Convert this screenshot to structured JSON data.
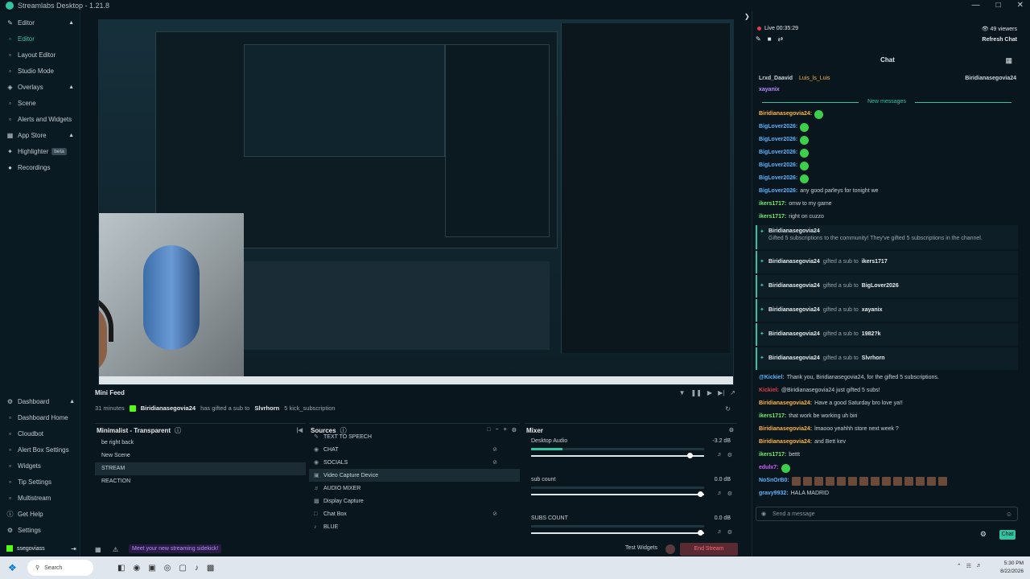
{
  "window": {
    "title": "Streamlabs Desktop - 1.21.8"
  },
  "sidebar": {
    "items": [
      {
        "label": "Editor",
        "kind": "section"
      },
      {
        "label": "Editor",
        "kind": "sub",
        "active": true
      },
      {
        "label": "Layout Editor",
        "kind": "sub"
      },
      {
        "label": "Studio Mode",
        "kind": "sub"
      },
      {
        "label": "Overlays",
        "kind": "section"
      },
      {
        "label": "Scene",
        "kind": "sub"
      },
      {
        "label": "Alerts and Widgets",
        "kind": "sub"
      },
      {
        "label": "App Store",
        "kind": "section"
      },
      {
        "label": "Highlighter",
        "kind": "section",
        "badge": "beta"
      },
      {
        "label": "Recordings",
        "kind": "section"
      }
    ],
    "dashboard": [
      {
        "label": "Dashboard",
        "kind": "section"
      },
      {
        "label": "Dashboard Home",
        "kind": "sub"
      },
      {
        "label": "Cloudbot",
        "kind": "sub"
      },
      {
        "label": "Alert Box Settings",
        "kind": "sub"
      },
      {
        "label": "Widgets",
        "kind": "sub"
      },
      {
        "label": "Tip Settings",
        "kind": "sub"
      },
      {
        "label": "Multistream",
        "kind": "sub"
      },
      {
        "label": "Get Help",
        "kind": "section"
      },
      {
        "label": "Settings",
        "kind": "section"
      }
    ],
    "user": "ssegoviass"
  },
  "minifeed": {
    "title": "Mini Feed",
    "time": "31 minutes",
    "gifter": "Biridianasegovia24",
    "action": "has gifted a sub to",
    "recipient": "Slvrhorn",
    "suffix": "5 kick_subscription"
  },
  "scenes": {
    "title": "Minimalist - Transparent",
    "items": [
      "be right back",
      "New Scene",
      "STREAM",
      "REACTION"
    ],
    "selected": "STREAM"
  },
  "sources": {
    "title": "Sources",
    "items": [
      {
        "label": "TEXT TO SPEECH",
        "icon": "text-icon"
      },
      {
        "label": "CHAT",
        "icon": "browser-icon"
      },
      {
        "label": "SOCIALS",
        "icon": "browser-icon"
      },
      {
        "label": "Video Capture Device",
        "icon": "camera-icon",
        "selected": true
      },
      {
        "label": "AUDIO MIXER",
        "icon": "mixer-icon"
      },
      {
        "label": "Display Capture",
        "icon": "display-icon"
      },
      {
        "label": "Chat Box",
        "icon": "chat-icon"
      },
      {
        "label": "BLUE",
        "icon": "mic-icon"
      }
    ]
  },
  "mixer": {
    "title": "Mixer",
    "channels": [
      {
        "name": "Desktop Audio",
        "db": "-3.2 dB",
        "level": 0.18,
        "fader": 0.92
      },
      {
        "name": "sub count",
        "db": "0.0 dB",
        "level": 0,
        "fader": 0.98
      },
      {
        "name": "SUBS COUNT",
        "db": "0.0 dB",
        "level": 0,
        "fader": 0.98
      }
    ]
  },
  "footer": {
    "sidekick": "Meet your new streaming sidekick!",
    "test_widgets": "Test Widgets",
    "end_stream": "End Stream"
  },
  "chat": {
    "live": "Live 00:35:29",
    "viewers": "49 viewers",
    "refresh": "Refresh Chat",
    "title": "Chat",
    "pinned": [
      "Lrxd_Daavid",
      "Luis_ls_Luis",
      "Biridianasegovia24"
    ],
    "new_messages": "New messages",
    "messages": [
      {
        "user": "xayanix",
        "text": "",
        "color": "#b58cff"
      },
      {
        "user": "Biridianasegovia24:",
        "text": "",
        "color": "#ffb640"
      },
      {
        "user": "BigLover2026:",
        "text": "",
        "color": "#5ab4ff"
      },
      {
        "user": "BigLover2026:",
        "text": "",
        "color": "#5ab4ff"
      },
      {
        "user": "BigLover2026:",
        "text": "",
        "color": "#5ab4ff"
      },
      {
        "user": "BigLover2026:",
        "text": "",
        "color": "#5ab4ff"
      },
      {
        "user": "BigLover2026:",
        "text": "",
        "color": "#5ab4ff"
      },
      {
        "user": "BigLover2026:",
        "text": "any good parleys for tonight we",
        "color": "#5ab4ff"
      },
      {
        "user": "ikers1717:",
        "text": "omw to my game",
        "color": "#6ff06f"
      },
      {
        "user": "ikers1717:",
        "text": "right on cuzzo",
        "color": "#6ff06f"
      }
    ],
    "gift_header": {
      "user": "Biridianasegovia24",
      "text": "Gifted 5 subscriptions to the community! They've gifted 5 subscriptions in the channel."
    },
    "gifts": [
      {
        "from": "Biridianasegovia24",
        "mid": "gifted a sub to",
        "to": "ikers1717"
      },
      {
        "from": "Biridianasegovia24",
        "mid": "gifted a sub to",
        "to": "BigLover2026"
      },
      {
        "from": "Biridianasegovia24",
        "mid": "gifted a sub to",
        "to": "xayanix"
      },
      {
        "from": "Biridianasegovia24",
        "mid": "gifted a sub to",
        "to": "1982?k"
      },
      {
        "from": "Biridianasegovia24",
        "mid": "gifted a sub to",
        "to": "Slvrhorn"
      }
    ],
    "tail": [
      {
        "user": "@Kickiel:",
        "text": "Thank you, Biridianasegovia24, for the gifted 5 subscriptions.",
        "color": "#5ab4ff"
      },
      {
        "user": "Kickiel:",
        "text": "@Biridianasegovia24 just gifted 5 subs!",
        "color": "#e23d4f"
      },
      {
        "user": "Biridianasegovia24:",
        "text": "Have a good Saturday bro love ya!!",
        "color": "#ffb640"
      },
      {
        "user": "ikers1717:",
        "text": "that work be working uh biri",
        "color": "#6ff06f"
      },
      {
        "user": "Biridianasegovia24:",
        "text": "lmaooo yeahhh store next week ?",
        "color": "#ffb640"
      },
      {
        "user": "Biridianasegovia24:",
        "text": "and Bett kev",
        "color": "#ffb640"
      },
      {
        "user": "ikers1717:",
        "text": "bettt",
        "color": "#6ff06f"
      },
      {
        "user": "edulx7:",
        "text": "",
        "color": "#d162ff"
      },
      {
        "user": "NoSnOrB0:",
        "text": "",
        "color": "#5ab4ff"
      },
      {
        "user": "gravy9932:",
        "text": "HALA MADRID",
        "color": "#5ab4ff"
      }
    ],
    "input_placeholder": "Send a message",
    "send": "Chat"
  },
  "taskbar": {
    "search": "Search",
    "time": "5:30 PM",
    "date": "8/22/2026"
  }
}
